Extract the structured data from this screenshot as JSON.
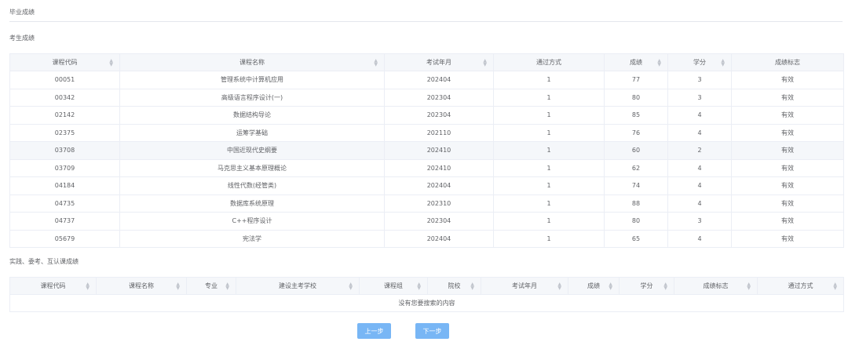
{
  "page_title": "毕业成绩",
  "exam_section": {
    "title": "考生成绩",
    "columns": [
      "课程代码",
      "课程名称",
      "考试年月",
      "通过方式",
      "成绩",
      "学分",
      "成绩标志"
    ],
    "rows": [
      [
        "00051",
        "管理系统中计算机应用",
        "202404",
        "1",
        "77",
        "3",
        "有效"
      ],
      [
        "00342",
        "高级语言程序设计(一)",
        "202304",
        "1",
        "80",
        "3",
        "有效"
      ],
      [
        "02142",
        "数据结构导论",
        "202304",
        "1",
        "85",
        "4",
        "有效"
      ],
      [
        "02375",
        "运筹学基础",
        "202110",
        "1",
        "76",
        "4",
        "有效"
      ],
      [
        "03708",
        "中国近现代史纲要",
        "202410",
        "1",
        "60",
        "2",
        "有效"
      ],
      [
        "03709",
        "马克思主义基本原理概论",
        "202410",
        "1",
        "62",
        "4",
        "有效"
      ],
      [
        "04184",
        "线性代数(经管类)",
        "202404",
        "1",
        "74",
        "4",
        "有效"
      ],
      [
        "04735",
        "数据库系统原理",
        "202310",
        "1",
        "88",
        "4",
        "有效"
      ],
      [
        "04737",
        "C++程序设计",
        "202304",
        "1",
        "80",
        "3",
        "有效"
      ],
      [
        "05679",
        "宪法学",
        "202404",
        "1",
        "65",
        "4",
        "有效"
      ]
    ]
  },
  "practice_section": {
    "title": "实践、委考、互认课成绩",
    "columns": [
      "课程代码",
      "课程名称",
      "专业",
      "建设主考学校",
      "课程组",
      "院校",
      "考试年月",
      "成绩",
      "学分",
      "成绩标志",
      "通过方式"
    ],
    "empty_text": "没有您要搜索的内容"
  },
  "buttons": {
    "prev": "上一步",
    "next": "下一步"
  },
  "colors": {
    "button": "#78b6f5",
    "header_bg": "#f5f7fa",
    "border": "#ebeef5"
  }
}
